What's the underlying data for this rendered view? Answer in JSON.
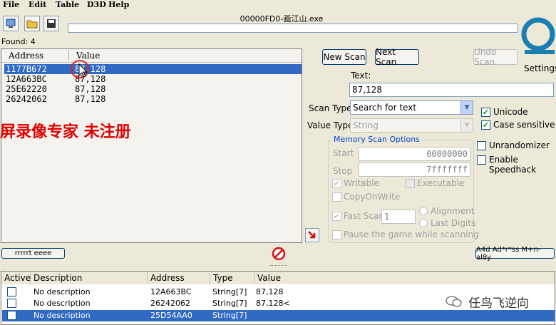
{
  "menu": [
    "File",
    "Edit",
    "Table",
    "D3D",
    "Help"
  ],
  "window_title": "00000FD0-画江山.exe",
  "found_label": "Found: 4",
  "results": {
    "headers": {
      "address": "Address",
      "value": "Value"
    },
    "rows": [
      {
        "address": "1177B672",
        "value": "87,128"
      },
      {
        "address": "12A663BC",
        "value": "87,128"
      },
      {
        "address": "25E62220",
        "value": "87,128"
      },
      {
        "address": "26242062",
        "value": "87,128"
      }
    ]
  },
  "watermark_text": "屏录像专家  未注册",
  "buttons": {
    "new_scan": "New Scan",
    "next_scan": "Next Scan",
    "undo_scan": "Undo Scan",
    "settings": "Settings",
    "memory_view": "rrrrrt eeee",
    "add_address": "A4d Ad*r*ss M+n-al8y"
  },
  "scan": {
    "text_label": "Text:",
    "text_value": "87,128",
    "scan_type_label": "Scan Type",
    "scan_type_value": "Search for text",
    "value_type_label": "Value Type",
    "value_type_value": "String"
  },
  "memory_options": {
    "title": "Memory Scan Options",
    "start_label": "Start",
    "start_value": "00000000",
    "stop_label": "Stop",
    "stop_value": "7fffffff",
    "writable": "Writable",
    "executable": "Executable",
    "copy_on_write": "CopyOnWrite",
    "fast_scan": "Fast Scan",
    "fast_scan_value": "1",
    "alignment": "Alignment",
    "last_digits": "Last Digits",
    "pause_game": "Pause the game while scanning"
  },
  "options": {
    "unicode": "Unicode",
    "case_sensitive": "Case sensitive",
    "unrandomizer": "Unrandomizer",
    "enable_speedhack": "Enable Speedhack"
  },
  "address_table": {
    "headers": {
      "active": "Active",
      "description": "Description",
      "address": "Address",
      "type": "Type",
      "value": "Value"
    },
    "rows": [
      {
        "description": "No description",
        "address": "12A663BC",
        "type": "String[7]",
        "value": "87,128"
      },
      {
        "description": "No description",
        "address": "26242062",
        "type": "String[7]",
        "value": "87,128<"
      },
      {
        "description": "No description",
        "address": "25D54AA0",
        "type": "String[7]",
        "value": ""
      }
    ]
  },
  "wechat_watermark": "任鸟飞逆向",
  "colors": {
    "selection": "#316ac5",
    "watermark_red": "#e00000",
    "group_title": "#0046d5"
  }
}
